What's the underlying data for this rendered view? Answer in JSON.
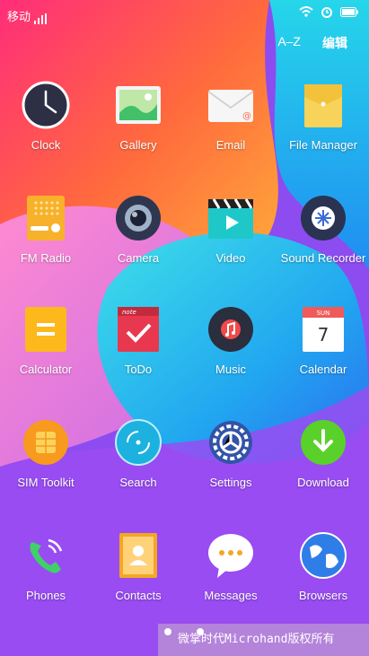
{
  "status": {
    "carrier": "移动"
  },
  "header": {
    "sort_label": "A–Z",
    "edit_label": "编辑"
  },
  "apps": [
    {
      "label": "Clock",
      "icon": "clock-icon"
    },
    {
      "label": "Gallery",
      "icon": "gallery-icon"
    },
    {
      "label": "Email",
      "icon": "email-icon"
    },
    {
      "label": "File Manager",
      "icon": "folder-icon"
    },
    {
      "label": "FM Radio",
      "icon": "radio-icon"
    },
    {
      "label": "Camera",
      "icon": "camera-icon"
    },
    {
      "label": "Video",
      "icon": "video-icon"
    },
    {
      "label": "Sound Recorder",
      "icon": "recorder-icon"
    },
    {
      "label": "Calculator",
      "icon": "calculator-icon"
    },
    {
      "label": "ToDo",
      "icon": "todo-icon"
    },
    {
      "label": "Music",
      "icon": "music-icon"
    },
    {
      "label": "Calendar",
      "icon": "calendar-icon",
      "month": "SUN",
      "day": "7"
    },
    {
      "label": "SIM Toolkit",
      "icon": "sim-icon"
    },
    {
      "label": "Search",
      "icon": "search-icon"
    },
    {
      "label": "Settings",
      "icon": "gear-icon"
    },
    {
      "label": "Download",
      "icon": "download-icon"
    },
    {
      "label": "Phones",
      "icon": "phone-icon"
    },
    {
      "label": "Contacts",
      "icon": "contacts-icon"
    },
    {
      "label": "Messages",
      "icon": "messages-icon"
    },
    {
      "label": "Browsers",
      "icon": "globe-icon"
    }
  ],
  "todo_note": "note",
  "watermark": "微掌时代Microhand版权所有"
}
